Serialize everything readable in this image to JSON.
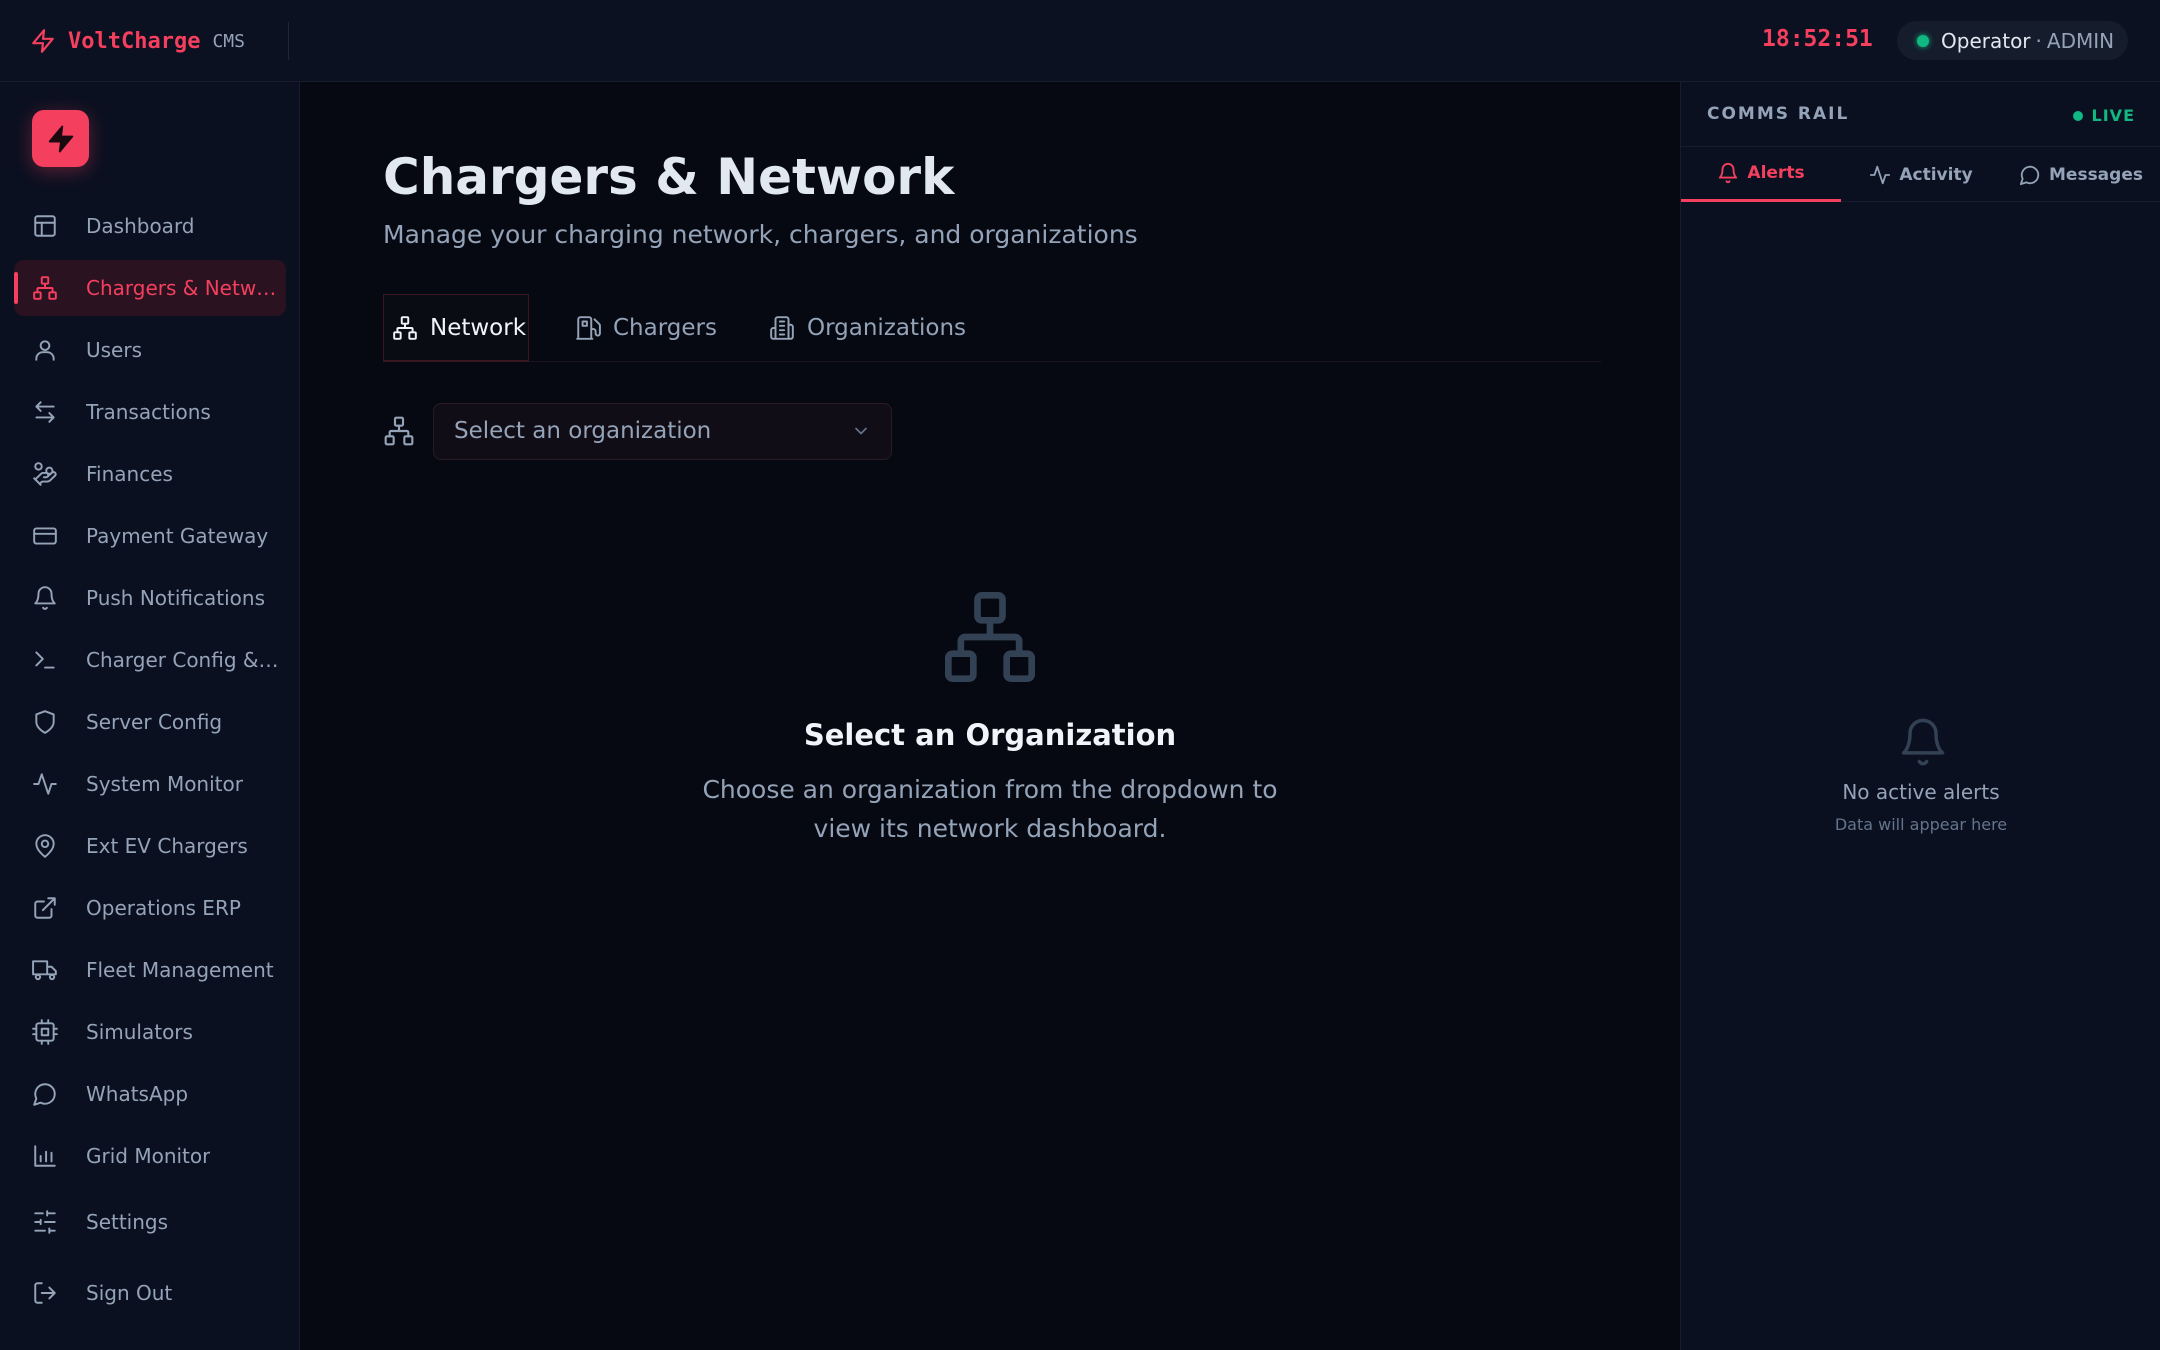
{
  "topbar": {
    "brand_name": "VoltCharge",
    "brand_tag": "CMS",
    "clock": "18:52:51",
    "user_name": "Operator",
    "user_sep": "·",
    "user_role": "ADMIN",
    "brand_icon": "zap-icon"
  },
  "sidebar": {
    "logo_icon": "zap-icon",
    "items": [
      {
        "label": "Dashboard",
        "icon": "layout-icon"
      },
      {
        "label": "Chargers & Network",
        "icon": "network-icon",
        "active": true
      },
      {
        "label": "Users",
        "icon": "user-icon"
      },
      {
        "label": "Transactions",
        "icon": "arrows-icon"
      },
      {
        "label": "Finances",
        "icon": "hand-coins-icon"
      },
      {
        "label": "Payment Gateway",
        "icon": "credit-card-icon"
      },
      {
        "label": "Push Notifications",
        "icon": "bell-icon"
      },
      {
        "label": "Charger Config & OCPP",
        "icon": "terminal-icon"
      },
      {
        "label": "Server Config",
        "icon": "shield-icon"
      },
      {
        "label": "System Monitor",
        "icon": "activity-icon"
      },
      {
        "label": "Ext EV Chargers",
        "icon": "map-pin-icon"
      },
      {
        "label": "Operations ERP",
        "icon": "external-link-icon"
      },
      {
        "label": "Fleet Management",
        "icon": "truck-icon"
      },
      {
        "label": "Simulators",
        "icon": "cpu-icon"
      },
      {
        "label": "WhatsApp",
        "icon": "message-circle-icon"
      },
      {
        "label": "Grid Monitor",
        "icon": "bar-chart-icon"
      },
      {
        "label": "Settings",
        "icon": "sliders-icon"
      },
      {
        "label": "Sign Out",
        "icon": "log-out-icon"
      }
    ]
  },
  "main": {
    "title": "Chargers & Network",
    "subtitle": "Manage your charging network, chargers, and organizations",
    "tabs": [
      {
        "label": "Network",
        "icon": "network-icon",
        "active": true
      },
      {
        "label": "Chargers",
        "icon": "fuel-icon"
      },
      {
        "label": "Organizations",
        "icon": "building-icon"
      }
    ],
    "org_select_placeholder": "Select an organization",
    "empty_title": "Select an Organization",
    "empty_desc": "Choose an organization from the dropdown to view its network dashboard."
  },
  "rail": {
    "title": "COMMS RAIL",
    "live": "LIVE",
    "tabs": [
      {
        "label": "Alerts",
        "icon": "bell-icon",
        "active": true
      },
      {
        "label": "Activity",
        "icon": "activity-icon"
      },
      {
        "label": "Messages",
        "icon": "message-circle-icon"
      }
    ],
    "empty_title": "No active alerts",
    "empty_sub": "Data will appear here"
  },
  "colors": {
    "accent": "#f43f5e",
    "live": "#10b981",
    "background": "#060911",
    "panel": "#0b1020"
  }
}
